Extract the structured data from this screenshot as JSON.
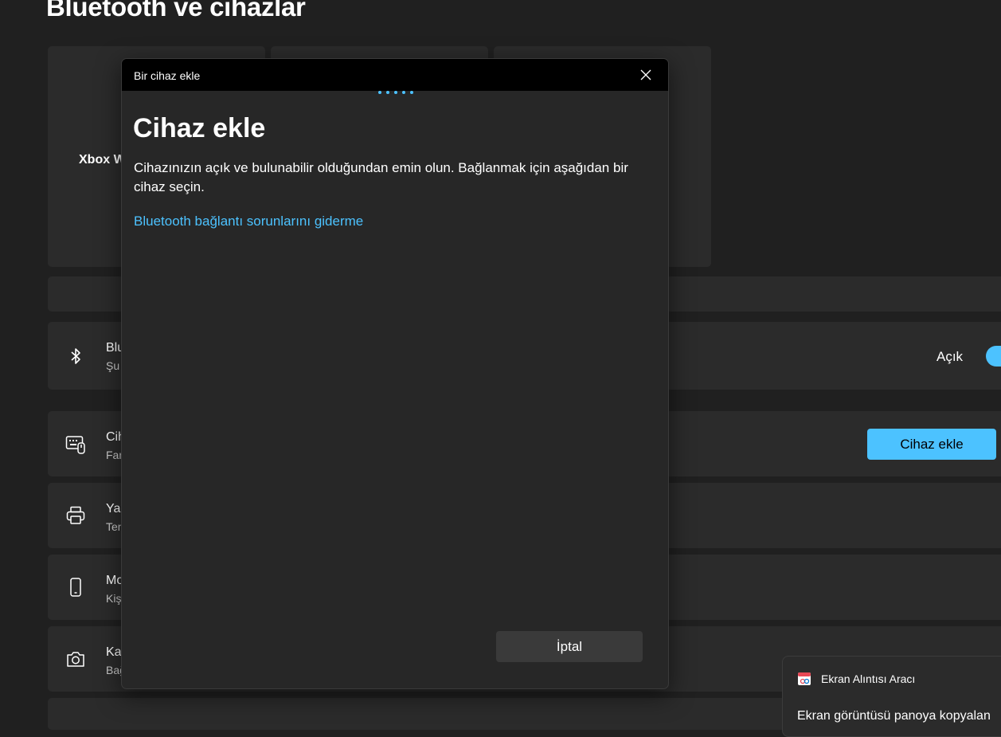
{
  "page": {
    "title": "Bluetooth ve cihazlar"
  },
  "devices": {
    "xbox_label": "Xbox W"
  },
  "rows": {
    "bluetooth": {
      "title": "Blu",
      "subtitle": "Şu",
      "state_label": "Açık"
    },
    "devices": {
      "title": "Cih",
      "subtitle": "Far",
      "add_button": "Cihaz ekle"
    },
    "printers": {
      "title": "Yaz",
      "subtitle": "Ten"
    },
    "mobile": {
      "title": "Mo",
      "subtitle": "Kiş"
    },
    "camera": {
      "title": "Ka",
      "subtitle": "Bağ"
    }
  },
  "dialog": {
    "window_title": "Bir cihaz ekle",
    "heading": "Cihaz ekle",
    "description": "Cihazınızın açık ve bulunabilir olduğundan emin olun. Bağlanmak için aşağıdan bir cihaz seçin.",
    "troubleshoot_link": "Bluetooth bağlantı sorunlarını giderme",
    "cancel_label": "İptal"
  },
  "toast": {
    "app_name": "Ekran Alıntısı Aracı",
    "message": "Ekran görüntüsü panoya kopyalan"
  },
  "colors": {
    "accent": "#4cc2ff",
    "background": "#202020",
    "card": "#2b2b2b"
  }
}
